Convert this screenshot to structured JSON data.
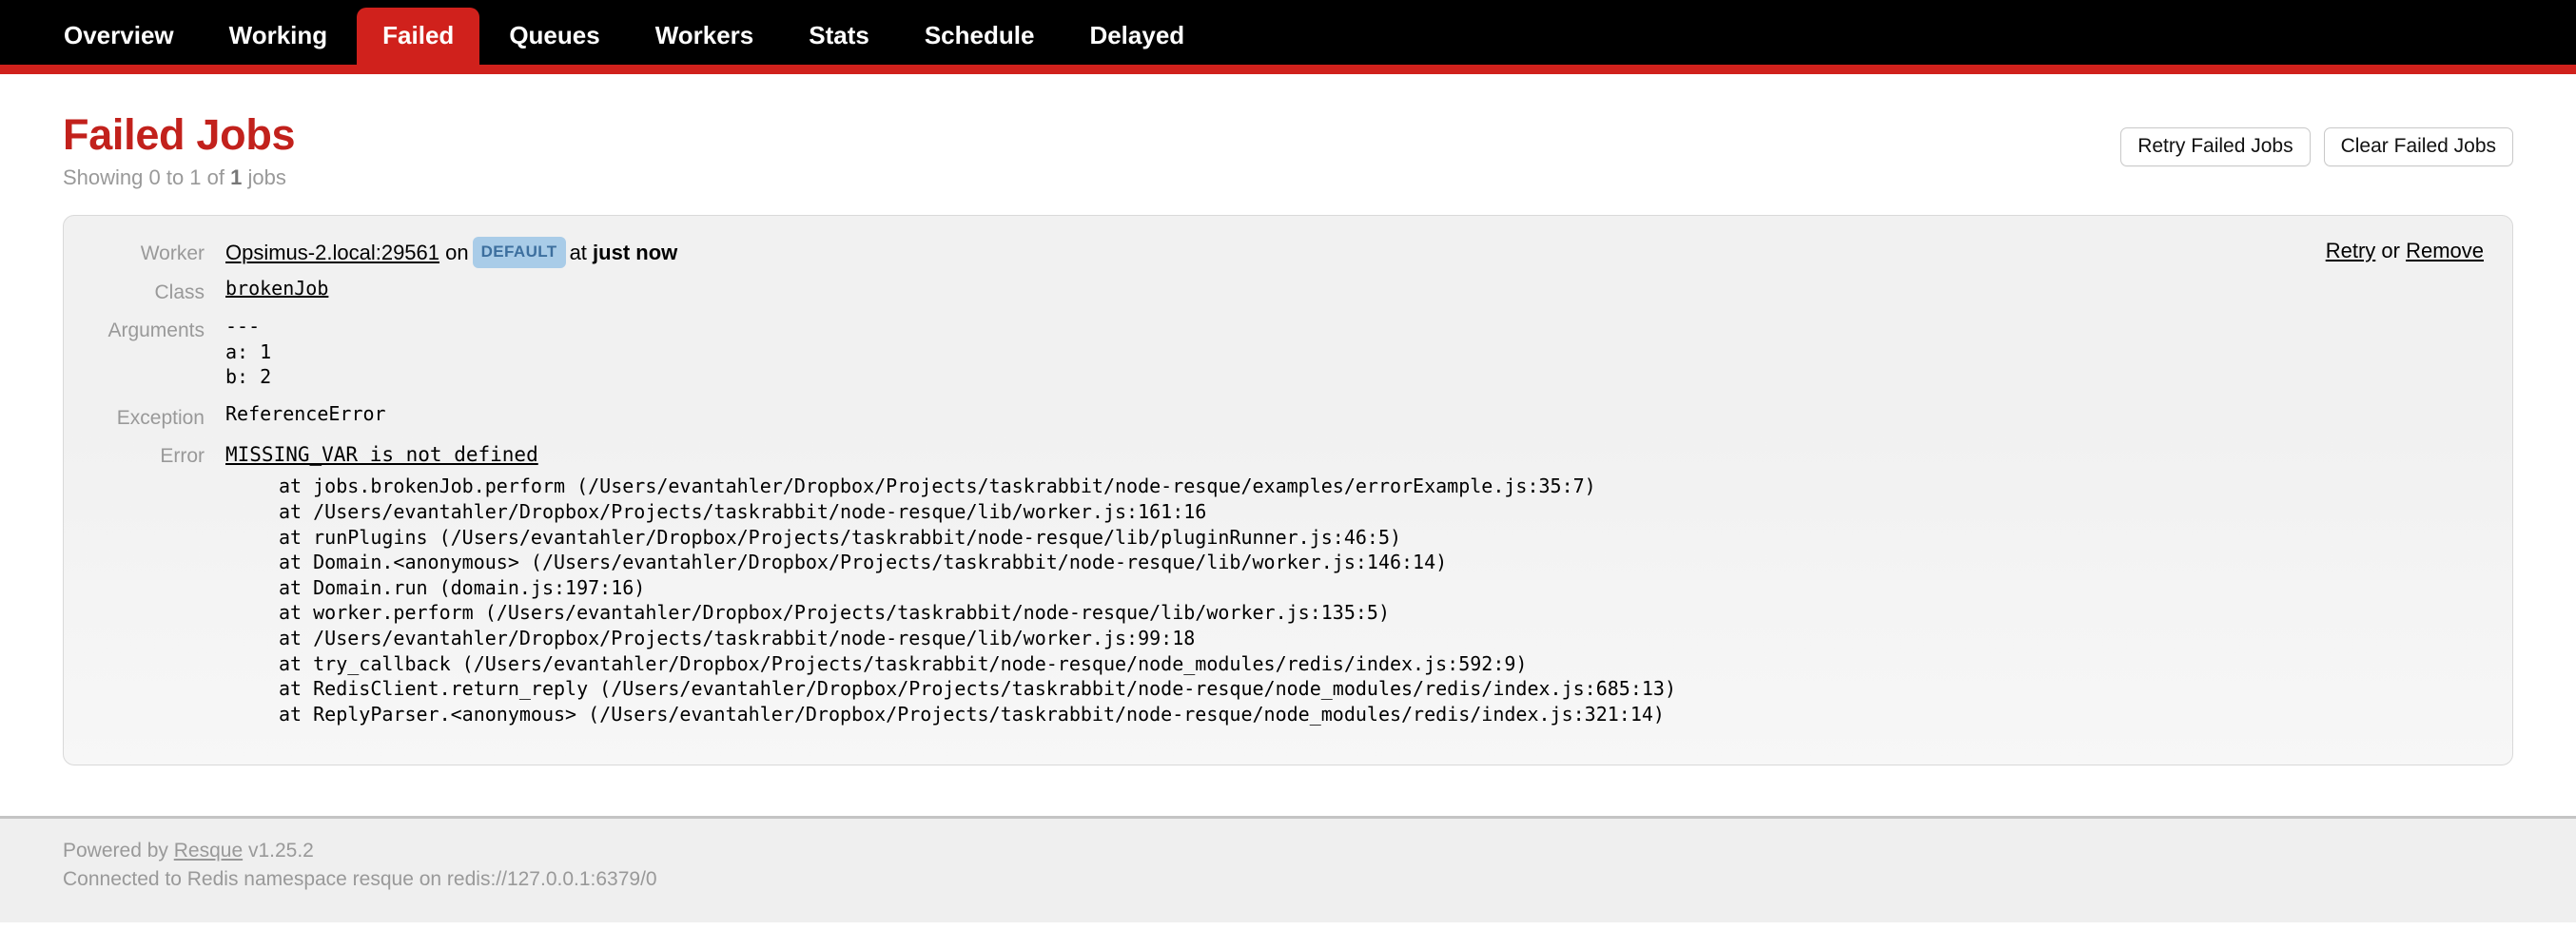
{
  "nav": {
    "items": [
      {
        "label": "Overview",
        "active": false
      },
      {
        "label": "Working",
        "active": false
      },
      {
        "label": "Failed",
        "active": true
      },
      {
        "label": "Queues",
        "active": false
      },
      {
        "label": "Workers",
        "active": false
      },
      {
        "label": "Stats",
        "active": false
      },
      {
        "label": "Schedule",
        "active": false
      },
      {
        "label": "Delayed",
        "active": false
      }
    ],
    "active_color": "#d0211c",
    "bar_color": "#000000"
  },
  "page": {
    "title": "Failed Jobs",
    "title_color": "#c2211c",
    "showing_prefix": "Showing 0 to 1 of ",
    "showing_count": "1",
    "showing_suffix": " jobs"
  },
  "actions": {
    "retry_failed_jobs": "Retry Failed Jobs",
    "clear_failed_jobs": "Clear Failed Jobs"
  },
  "job": {
    "labels": {
      "worker": "Worker",
      "class": "Class",
      "arguments": "Arguments",
      "exception": "Exception",
      "error": "Error"
    },
    "worker_name": "Opsimus-2.local:29561",
    "worker_on": "on",
    "queue_badge": "DEFAULT",
    "queue_badge_bg": "#a9cce8",
    "queue_badge_color": "#3d6f9e",
    "worker_at": "at",
    "worker_time": "just now",
    "class_name": "brokenJob",
    "arguments": "---\na: 1\nb: 2",
    "exception": "ReferenceError",
    "error_message": "MISSING_VAR is not defined",
    "backtrace": "at jobs.brokenJob.perform (/Users/evantahler/Dropbox/Projects/taskrabbit/node-resque/examples/errorExample.js:35:7)\nat /Users/evantahler/Dropbox/Projects/taskrabbit/node-resque/lib/worker.js:161:16\nat runPlugins (/Users/evantahler/Dropbox/Projects/taskrabbit/node-resque/lib/pluginRunner.js:46:5)\nat Domain.<anonymous> (/Users/evantahler/Dropbox/Projects/taskrabbit/node-resque/lib/worker.js:146:14)\nat Domain.run (domain.js:197:16)\nat worker.perform (/Users/evantahler/Dropbox/Projects/taskrabbit/node-resque/lib/worker.js:135:5)\nat /Users/evantahler/Dropbox/Projects/taskrabbit/node-resque/lib/worker.js:99:18\nat try_callback (/Users/evantahler/Dropbox/Projects/taskrabbit/node-resque/node_modules/redis/index.js:592:9)\nat RedisClient.return_reply (/Users/evantahler/Dropbox/Projects/taskrabbit/node-resque/node_modules/redis/index.js:685:13)\nat ReplyParser.<anonymous> (/Users/evantahler/Dropbox/Projects/taskrabbit/node-resque/node_modules/redis/index.js:321:14)",
    "row_retry": "Retry",
    "row_or": "or",
    "row_remove": "Remove"
  },
  "footer": {
    "powered_prefix": "Powered by ",
    "powered_link": "Resque",
    "version": " v1.25.2",
    "connection": "Connected to Redis namespace resque on redis://127.0.0.1:6379/0"
  }
}
